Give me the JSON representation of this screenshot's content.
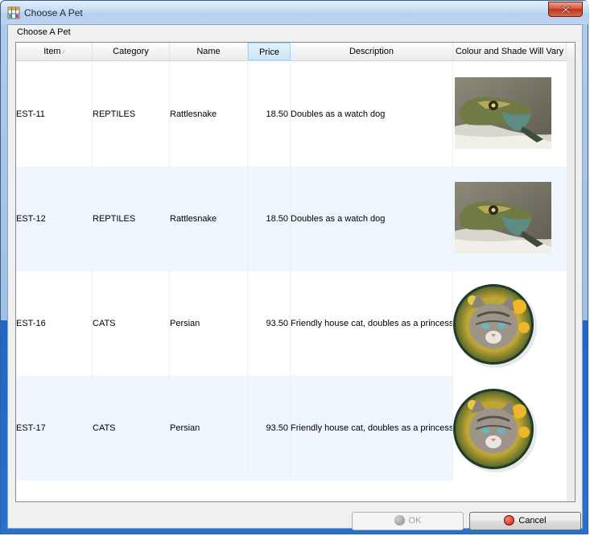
{
  "window": {
    "title": "Choose A Pet"
  },
  "panel": {
    "label": "Choose A Pet"
  },
  "table": {
    "columns": [
      {
        "label": "Item"
      },
      {
        "label": "Category"
      },
      {
        "label": "Name"
      },
      {
        "label": "Price"
      },
      {
        "label": "Description"
      },
      {
        "label": "Colour and Shade Will Vary"
      }
    ],
    "rows": [
      {
        "item": "EST-11",
        "category": "REPTILES",
        "name": "Rattlesnake",
        "price": "18.50",
        "description": "Doubles as a watch dog",
        "image": "lizard"
      },
      {
        "item": "EST-12",
        "category": "REPTILES",
        "name": "Rattlesnake",
        "price": "18.50",
        "description": "Doubles as a watch dog",
        "image": "lizard"
      },
      {
        "item": "EST-16",
        "category": "CATS",
        "name": "Persian",
        "price": "93.50",
        "description": "Friendly house cat, doubles as a princess",
        "image": "kitten"
      },
      {
        "item": "EST-17",
        "category": "CATS",
        "name": "Persian",
        "price": "93.50",
        "description": "Friendly house cat, doubles as a princess",
        "image": "kitten"
      }
    ]
  },
  "buttons": {
    "ok": "OK",
    "cancel": "Cancel"
  },
  "icons": {
    "app": "table-grid-icon",
    "close": "close-icon",
    "ok": "gray-circle-icon",
    "cancel": "red-circle-icon"
  },
  "colors": {
    "selected_header": "#cbe6f8",
    "alt_row": "#eff6fd",
    "close_button": "#c1321b"
  }
}
